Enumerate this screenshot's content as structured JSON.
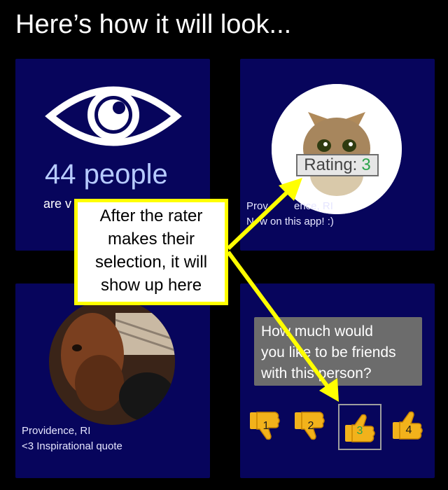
{
  "page": {
    "title": "Here’s how it will look..."
  },
  "card_views": {
    "icon": "eye-icon",
    "count_text": "44 people",
    "sub_text_visible": "are v"
  },
  "card_profile": {
    "photo": "cat-photo",
    "rating_label": "Rating:",
    "rating_value": "3",
    "location_partial": "Prov",
    "location_tail": "ence, RI",
    "bio_start": "N",
    "bio_tail": "w on this app! :)"
  },
  "card_dog": {
    "photo": "dog-photo",
    "location": "Providence, RI",
    "quote": "<3 Inspirational quote"
  },
  "card_question": {
    "question_line1": "How much would",
    "question_line2": "you like to be friends",
    "question_line3": "with this person?",
    "options": [
      "1",
      "2",
      "3",
      "4"
    ],
    "selected": "3",
    "icons": [
      "thumbs-down-icon",
      "thumbs-down-icon",
      "thumbs-up-icon",
      "thumbs-up-icon"
    ]
  },
  "callout": {
    "line1": "After the rater",
    "line2": "makes their",
    "line3": "selection, it will",
    "line4": "show up here"
  },
  "colors": {
    "card_bg": "#07055c",
    "callout_border": "#ffff00",
    "rating_green": "#2aa34a"
  }
}
